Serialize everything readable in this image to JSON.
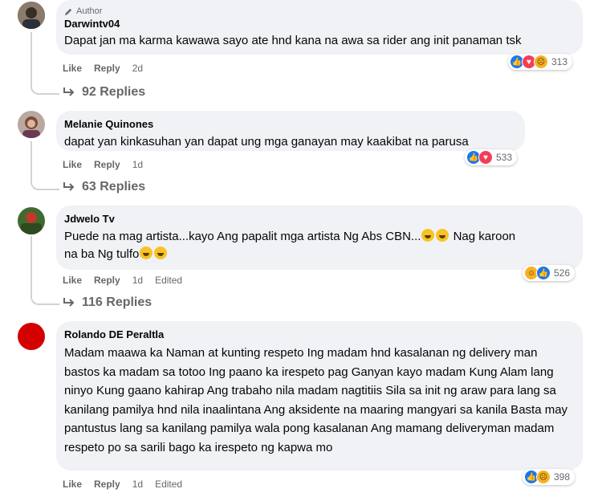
{
  "comments": [
    {
      "author_badge": "Author",
      "name": "Darwintv04",
      "text": "Dapat jan ma karma kawawa sayo ate hnd kana na awa sa rider ang init panaman tsk",
      "like": "Like",
      "reply": "Reply",
      "time": "2d",
      "edited": "",
      "reaction_count": "313",
      "reactions": [
        "like-icon",
        "love-icon",
        "sad-icon"
      ],
      "replies": "92 Replies"
    },
    {
      "name": "Melanie Quinones",
      "text": "dapat yan kinkasuhan yan dapat ung mga ganayan may kaakibat na parusa",
      "like": "Like",
      "reply": "Reply",
      "time": "1d",
      "edited": "",
      "reaction_count": "533",
      "reactions": [
        "like-icon",
        "love-icon"
      ],
      "replies": "63 Replies"
    },
    {
      "name": "Jdwelo Tv",
      "text_line1": "Puede na mag artista...kayo Ang papalit mga artista Ng Abs CBN...",
      "text_line1b": " Nag karoon",
      "text_line2": "na ba Ng tulfo",
      "like": "Like",
      "reply": "Reply",
      "time": "1d",
      "edited": "Edited",
      "reaction_count": "526",
      "reactions": [
        "haha-icon",
        "like-icon"
      ],
      "replies": "116 Replies"
    },
    {
      "name": "Rolando DE Peraltla",
      "text": "Madam maawa ka Naman at kunting respeto Ing madam hnd kasalanan ng delivery man bastos ka madam sa totoo Ing paano ka irespeto pag Ganyan kayo madam Kung Alam lang ninyo Kung gaano kahirap Ang trabaho nila madam nagtitiis Sila sa init ng araw para lang sa kanilang pamilya hnd nila inaalintana Ang aksidente na maaring mangyari sa kanila Basta may pantustus lang sa kanilang pamilya wala pong kasalanan Ang mamang deliveryman madam respeto po sa sarili bago ka irespeto ng kapwa mo",
      "like": "Like",
      "reply": "Reply",
      "time": "1d",
      "edited": "Edited",
      "reaction_count": "398",
      "reactions": [
        "like-icon",
        "sad-icon"
      ]
    }
  ]
}
